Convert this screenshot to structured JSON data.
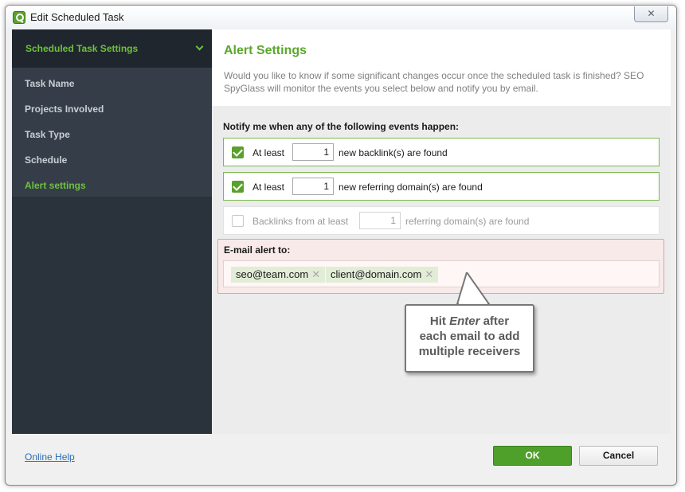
{
  "window": {
    "title": "Edit Scheduled Task",
    "close_glyph": "✕"
  },
  "sidebar": {
    "header": "Scheduled Task Settings",
    "items": [
      {
        "label": "Task Name"
      },
      {
        "label": "Projects Involved"
      },
      {
        "label": "Task Type"
      },
      {
        "label": "Schedule"
      },
      {
        "label": "Alert settings"
      }
    ]
  },
  "content": {
    "title": "Alert Settings",
    "description": "Would you like to know if some significant changes occur once the scheduled task is finished? SEO SpyGlass will monitor the events you select below and notify you by email.",
    "notify_label": "Notify me when any of the following events happen:",
    "events": [
      {
        "checked": true,
        "prefix": "At least",
        "value": "1",
        "suffix": "new backlink(s) are found"
      },
      {
        "checked": true,
        "prefix": "At least",
        "value": "1",
        "suffix": "new referring domain(s) are found"
      },
      {
        "checked": false,
        "prefix": "Backlinks from at least",
        "value": "1",
        "suffix": "referring domain(s) are found"
      }
    ],
    "email": {
      "label": "E-mail alert to:",
      "recipients": [
        "seo@team.com",
        "client@domain.com"
      ],
      "remove_glyph": "✕"
    }
  },
  "callout": {
    "line1_pre": "Hit ",
    "line1_em": "Enter",
    "line1_post": " after",
    "line2": "each email to add",
    "line3": "multiple receivers"
  },
  "footer": {
    "help": "Online Help",
    "ok": "OK",
    "cancel": "Cancel"
  },
  "colors": {
    "accent_green": "#5aa02c",
    "sidebar_dark": "#2a323b",
    "link_blue": "#2a6fb8"
  }
}
